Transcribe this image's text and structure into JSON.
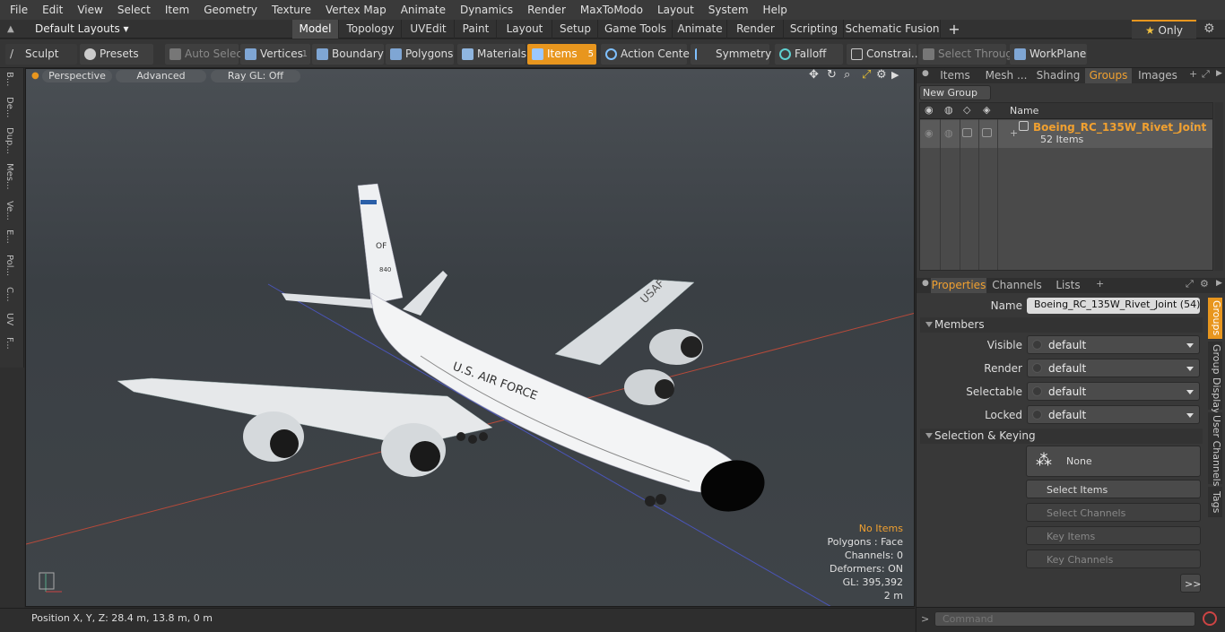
{
  "menu": [
    "File",
    "Edit",
    "View",
    "Select",
    "Item",
    "Geometry",
    "Texture",
    "Vertex Map",
    "Animate",
    "Dynamics",
    "Render",
    "MaxToModo",
    "Layout",
    "System",
    "Help"
  ],
  "layout_selector": "Default Layouts",
  "layout_tabs": [
    "Model",
    "Topology",
    "UVEdit",
    "Paint",
    "Layout",
    "Setup",
    "Game Tools",
    "Animate",
    "Render",
    "Scripting",
    "Schematic Fusion"
  ],
  "layout_tab_active": "Model",
  "add_tab": "+",
  "only_label": "Only",
  "toolbar": {
    "sculpt": "Sculpt",
    "presets": "Presets",
    "auto_select": "Auto Select",
    "vertices": "Vertices",
    "vertices_count": "1",
    "boundary": "Boundary",
    "polygons": "Polygons",
    "materials": "Materials",
    "items": "Items",
    "items_count": "5",
    "action_center": "Action Center",
    "symmetry": "Symmetry",
    "falloff": "Falloff",
    "constraints": "Constrai...",
    "select_through": "Select Through",
    "workplane": "WorkPlane"
  },
  "left_tabs": [
    "B...",
    "De...",
    "Dup...",
    "Mes...",
    "Ve...",
    "E...",
    "Pol...",
    "C...",
    "UV",
    "F..."
  ],
  "viewport": {
    "perspective": "Perspective",
    "advanced": "Advanced",
    "raygl": "Ray GL: Off",
    "info": {
      "items": "No Items",
      "polygons": "Polygons : Face",
      "channels": "Channels: 0",
      "deformers": "Deformers: ON",
      "gl": "GL: 395,392",
      "scale": "2 m"
    },
    "aircraft": {
      "side_text": "U.S. AIR FORCE",
      "tail_code": "OF",
      "wing_text": "USAF",
      "tail_number": "840"
    }
  },
  "status": {
    "position": "Position X, Y, Z:   28.4 m, 13.8 m, 0 m"
  },
  "right_tabs": [
    "Items",
    "Mesh ...",
    "Shading",
    "Groups",
    "Images"
  ],
  "right_tab_active": "Groups",
  "groups": {
    "new_group": "New Group",
    "name_header": "Name",
    "row_name": "Boeing_RC_135W_Rivet_Joint",
    "row_name_suffix": "( ...",
    "row_count": "52 Items"
  },
  "props_tabs": [
    "Properties",
    "Channels",
    "Lists"
  ],
  "props": {
    "name_label": "Name",
    "name_value": "Boeing_RC_135W_Rivet_Joint (54)",
    "members": "Members",
    "visible_label": "Visible",
    "visible_value": "default",
    "render_label": "Render",
    "render_value": "default",
    "selectable_label": "Selectable",
    "selectable_value": "default",
    "locked_label": "Locked",
    "locked_value": "default",
    "selkey": "Selection & Keying",
    "none": "None",
    "select_items": "Select Items",
    "select_channels": "Select Channels",
    "key_items": "Key Items",
    "key_channels": "Key Channels",
    "more": ">>"
  },
  "side_vtabs": [
    "Groups",
    "Group Display",
    "User Channels",
    "Tags"
  ],
  "command_placeholder": "Command",
  "colors": {
    "accent": "#e8961e",
    "group_name": "#f0a030"
  }
}
